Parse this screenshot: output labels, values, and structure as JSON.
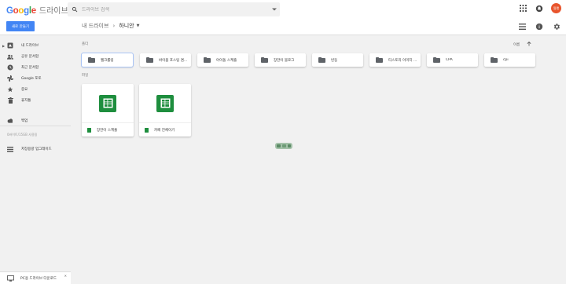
{
  "app": {
    "brand_letters": [
      "G",
      "o",
      "o",
      "g",
      "l",
      "e"
    ],
    "product": "드라이브"
  },
  "search": {
    "placeholder": "드라이브 검색"
  },
  "account": {
    "avatar_text": "알랜"
  },
  "toolbar": {
    "new_label": "새로 만들기"
  },
  "breadcrumb": {
    "root": "내 드라이브",
    "current": "하니안"
  },
  "sidebar": {
    "items": [
      {
        "label": "내 드라이브",
        "icon": "drive-icon"
      },
      {
        "label": "공유 문서함",
        "icon": "people-icon"
      },
      {
        "label": "최근 문서함",
        "icon": "clock-icon"
      },
      {
        "label": "Google 포토",
        "icon": "photos-icon"
      },
      {
        "label": "중요",
        "icon": "star-icon"
      },
      {
        "label": "휴지통",
        "icon": "trash-icon"
      },
      {
        "label": "백업",
        "icon": "cloud-icon"
      },
      {
        "label": "저장용량 업그레이드",
        "icon": "storage-icon"
      }
    ],
    "storage_text": "0바이트/15GB 사용됨"
  },
  "content": {
    "folders_label": "폴더",
    "files_label": "파일",
    "sort_label": "이름",
    "folders": [
      {
        "name": "웹크롤링"
      },
      {
        "name": "바이옵 포스팅 겸..."
      },
      {
        "name": "아이돌 스케쥴"
      },
      {
        "name": "장한이 블로그"
      },
      {
        "name": "빈둥"
      },
      {
        "name": "티스토리 이미지 뉴..."
      },
      {
        "name": "CPA"
      },
      {
        "name": "cpi"
      }
    ],
    "files": [
      {
        "name": "장한이 스케쥴"
      },
      {
        "name": "카페 전체이기"
      }
    ]
  },
  "footer": {
    "download_label": "PC용 드라이브 다운로드"
  },
  "colors": {
    "accent": "#4285f4",
    "sheets_green": "#1e8e3e",
    "avatar": "#e8542c"
  }
}
